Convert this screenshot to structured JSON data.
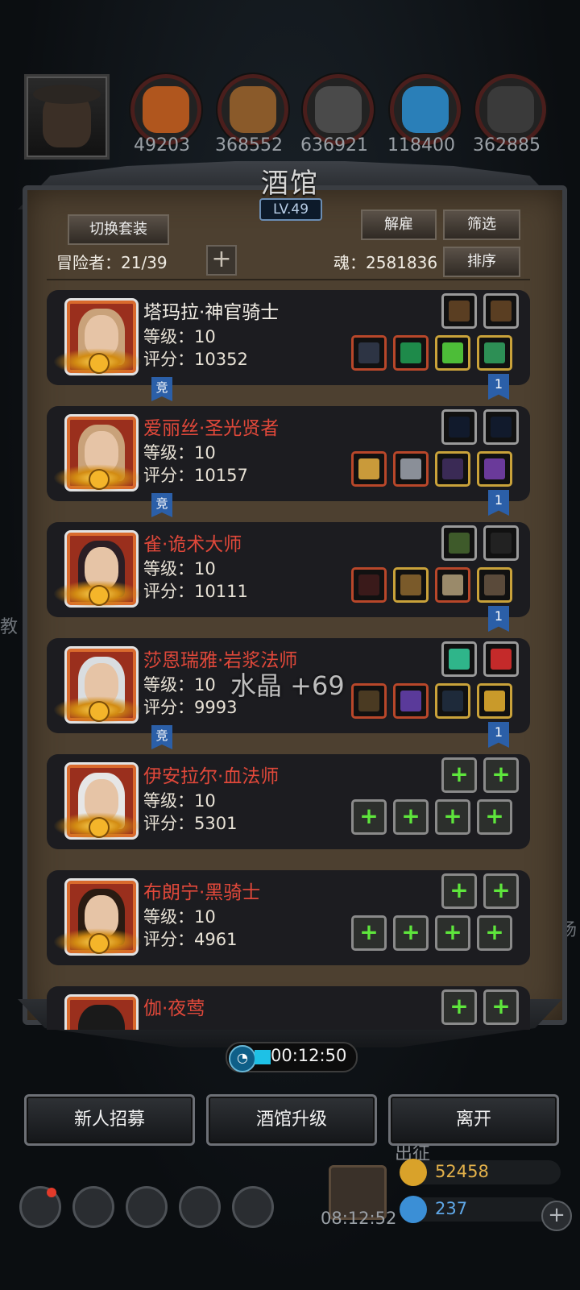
{
  "resources": [
    {
      "icon": "ore-icon",
      "value": "49203",
      "color": "#b0561e"
    },
    {
      "icon": "wood-icon",
      "value": "368552",
      "color": "#8a5a2a"
    },
    {
      "icon": "iron-icon",
      "value": "636921",
      "color": "#4a4a4a"
    },
    {
      "icon": "crystal-icon",
      "value": "118400",
      "color": "#2a7fb8"
    },
    {
      "icon": "stone-icon",
      "value": "362885",
      "color": "#3a3a3a"
    }
  ],
  "tavern": {
    "title": "酒馆",
    "level": "LV.49",
    "switch_outfit": "切换套装",
    "dismiss": "解雇",
    "filter": "筛选",
    "sort": "排序",
    "adventurers_label": "冒险者：21/39",
    "soul_label": "魂：2581836"
  },
  "heroes": [
    {
      "name": "塔玛拉·神官骑士",
      "name_color": "#f0ece4",
      "level": "等级：10",
      "score": "评分：10352",
      "comp": "竞",
      "rank": "1",
      "hair": "#c9a27a"
    },
    {
      "name": "爱丽丝·圣光贤者",
      "name_color": "#e0483a",
      "level": "等级：10",
      "score": "评分：10157",
      "comp": "竞",
      "rank": "1",
      "hair": "#c9a27a"
    },
    {
      "name": "雀·诡术大师",
      "name_color": "#e0483a",
      "level": "等级：10",
      "score": "评分：10111",
      "comp": "",
      "rank": "1",
      "hair": "#2b1e24"
    },
    {
      "name": "莎恩瑞雅·岩浆法师",
      "name_color": "#e0483a",
      "level": "等级：10",
      "score": "评分：9993",
      "comp": "竞",
      "rank": "1",
      "hair": "#d9dde0"
    },
    {
      "name": "伊安拉尔·血法师",
      "name_color": "#e0483a",
      "level": "等级：10",
      "score": "评分：5301",
      "comp": "",
      "rank": "",
      "hair": "#e6e6e6"
    },
    {
      "name": "布朗宁·黑骑士",
      "name_color": "#e0483a",
      "level": "等级：10",
      "score": "评分：4961",
      "comp": "",
      "rank": "",
      "hair": "#2a1b12"
    },
    {
      "name": "伽·夜莺",
      "name_color": "#e0483a",
      "level": "",
      "score": "",
      "comp": "",
      "rank": "",
      "hair": "#1a1a1a"
    }
  ],
  "floating_text": "水晶 +69",
  "timer": "00:12:50",
  "buttons": {
    "recruit": "新人招募",
    "upgrade": "酒馆升级",
    "leave": "离开"
  },
  "hud": {
    "gift_timer": "08:12:52",
    "gold": "52458",
    "gems": "237",
    "side_left": "教",
    "side_right": "场",
    "expedition": "出征"
  }
}
